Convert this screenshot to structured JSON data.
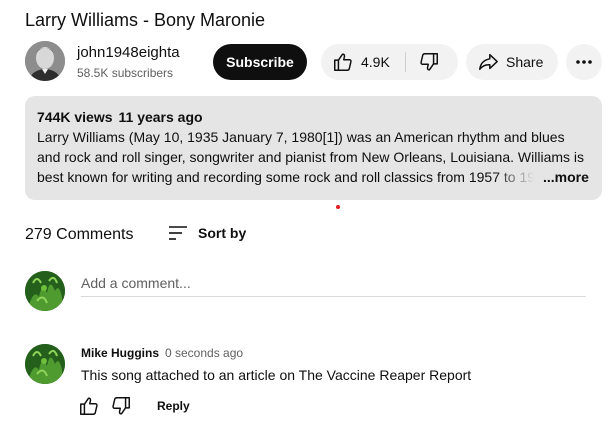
{
  "video": {
    "title": "Larry Williams - Bony Maronie"
  },
  "channel": {
    "name": "john1948eighta",
    "subscribers": "58.5K subscribers",
    "subscribe_label": "Subscribe"
  },
  "actions": {
    "like_count": "4.9K",
    "share_label": "Share",
    "icons": [
      "thumbs-up-icon",
      "thumbs-down-icon",
      "share-icon",
      "more-horizontal-icon"
    ]
  },
  "description": {
    "views": "744K views",
    "age": "11 years ago",
    "lines": [
      "Larry Williams (May 10, 1935  January 7, 1980[1]) was an American rhythm and blues",
      "and rock and roll singer, songwriter and pianist from New Orleans, Louisiana. Williams is",
      "best known for writing and recording some rock and roll classics from 1957 to 19"
    ],
    "more_label": "...more"
  },
  "comments": {
    "count_label": "279 Comments",
    "sort_label": "Sort by",
    "add_placeholder": "Add a comment...",
    "items": [
      {
        "author": "Mike Huggins",
        "time": "0 seconds ago",
        "text": "This song attached to an article on The Vaccine Reaper Report",
        "reply_label": "Reply"
      }
    ]
  },
  "colors": {
    "text_primary": "#0f0f0f",
    "text_secondary": "#606060",
    "button_dark": "#0f0f0f",
    "chip_bg": "#f2f2f2",
    "description_bg": "#e5e5e5",
    "indicator_red": "#e02020"
  }
}
